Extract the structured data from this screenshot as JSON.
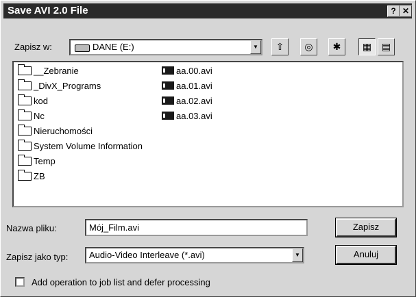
{
  "window": {
    "title": "Save AVI 2.0 File",
    "help_glyph": "?",
    "close_glyph": "✕"
  },
  "location": {
    "label": "Zapisz w:",
    "value": "DANE (E:)",
    "drive_icon": "drive-icon"
  },
  "toolbar": {
    "buttons": [
      {
        "name": "up-one-level-icon",
        "glyph": "⇧"
      },
      {
        "name": "desktop-icon",
        "glyph": "◎"
      },
      {
        "name": "new-folder-icon",
        "glyph": "✱"
      },
      {
        "name": "list-view-icon",
        "glyph": "▦"
      },
      {
        "name": "details-view-icon",
        "glyph": "▤"
      }
    ]
  },
  "files": {
    "folders": [
      "__Zebranie",
      "_DivX_Programs",
      "kod",
      "Nc",
      "Nieruchomości",
      "System Volume Information",
      "Temp",
      "ZB"
    ],
    "avi_files": [
      "aa.00.avi",
      "aa.01.avi",
      "aa.02.avi",
      "aa.03.avi"
    ]
  },
  "filename": {
    "label": "Nazwa pliku:",
    "value": "Mój_Film.avi"
  },
  "filetype": {
    "label": "Zapisz jako typ:",
    "value": "Audio-Video Interleave (*.avi)"
  },
  "buttons": {
    "save": "Zapisz",
    "cancel": "Anuluj"
  },
  "option": {
    "label": "Add operation to job list and defer processing",
    "checked": false
  }
}
